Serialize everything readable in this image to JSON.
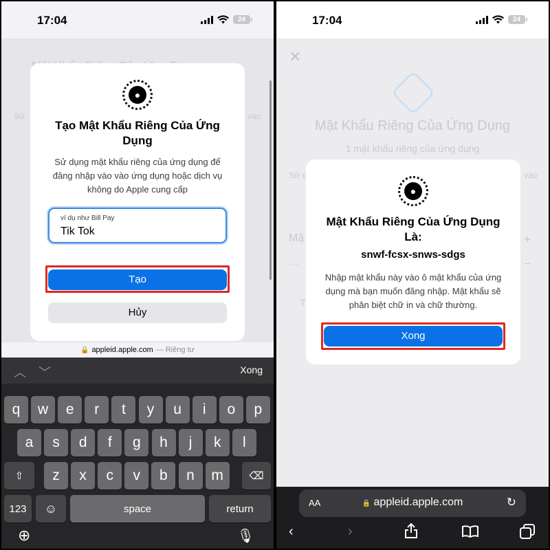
{
  "status": {
    "time": "17:04",
    "battery": "24"
  },
  "left": {
    "bg_lines": [
      "Mật Khẩu Riêng Của Ứng Dụng",
      "Sử",
      "vào"
    ],
    "dialog": {
      "title": "Tạo Mật Khẩu Riêng Của Ứng Dụng",
      "body": "Sử dụng mật khẩu riêng của ứng dụng để đăng nhập vào vào ứng dụng hoặc dịch vụ không do Apple cung cấp",
      "input_placeholder": "ví dụ như Bill Pay",
      "input_value": "Tik Tok",
      "create_label": "Tạo",
      "cancel_label": "Hủy"
    },
    "url_strip": {
      "domain": "appleid.apple.com",
      "suffix": "— Riêng tư"
    },
    "keyboard": {
      "done_label": "Xong",
      "row1": [
        "q",
        "w",
        "e",
        "r",
        "t",
        "y",
        "u",
        "i",
        "o",
        "p"
      ],
      "row2": [
        "a",
        "s",
        "d",
        "f",
        "g",
        "h",
        "j",
        "k",
        "l"
      ],
      "row3": [
        "z",
        "x",
        "c",
        "v",
        "b",
        "n",
        "m"
      ],
      "numbers_label": "123",
      "space_label": "space",
      "return_label": "return"
    }
  },
  "right": {
    "bg": {
      "title": "Mật Khẩu Riêng Của Ứng Dụng",
      "subtitle": "1 mật khẩu riêng của ứng dụng",
      "left_frag": "Sử c",
      "right_frag": "vào",
      "row_frag": "Mậ",
      "dots": "···",
      "plus": "+",
      "minus": "−",
      "t_frag": "T"
    },
    "dialog": {
      "title": "Mật Khẩu Riêng Của Ứng Dụng Là:",
      "password": "snwf-fcsx-snws-sdgs",
      "body": "Nhập mật khẩu này vào ô mật khẩu của ứng dụng mà bạn muốn đăng nhập. Mật khẩu sẽ phân biệt chữ in và chữ thường.",
      "done_label": "Xong"
    },
    "safari": {
      "aa": "AA",
      "domain": "appleid.apple.com"
    }
  },
  "colors": {
    "accent": "#0a72e6",
    "highlight": "#e0281e"
  }
}
